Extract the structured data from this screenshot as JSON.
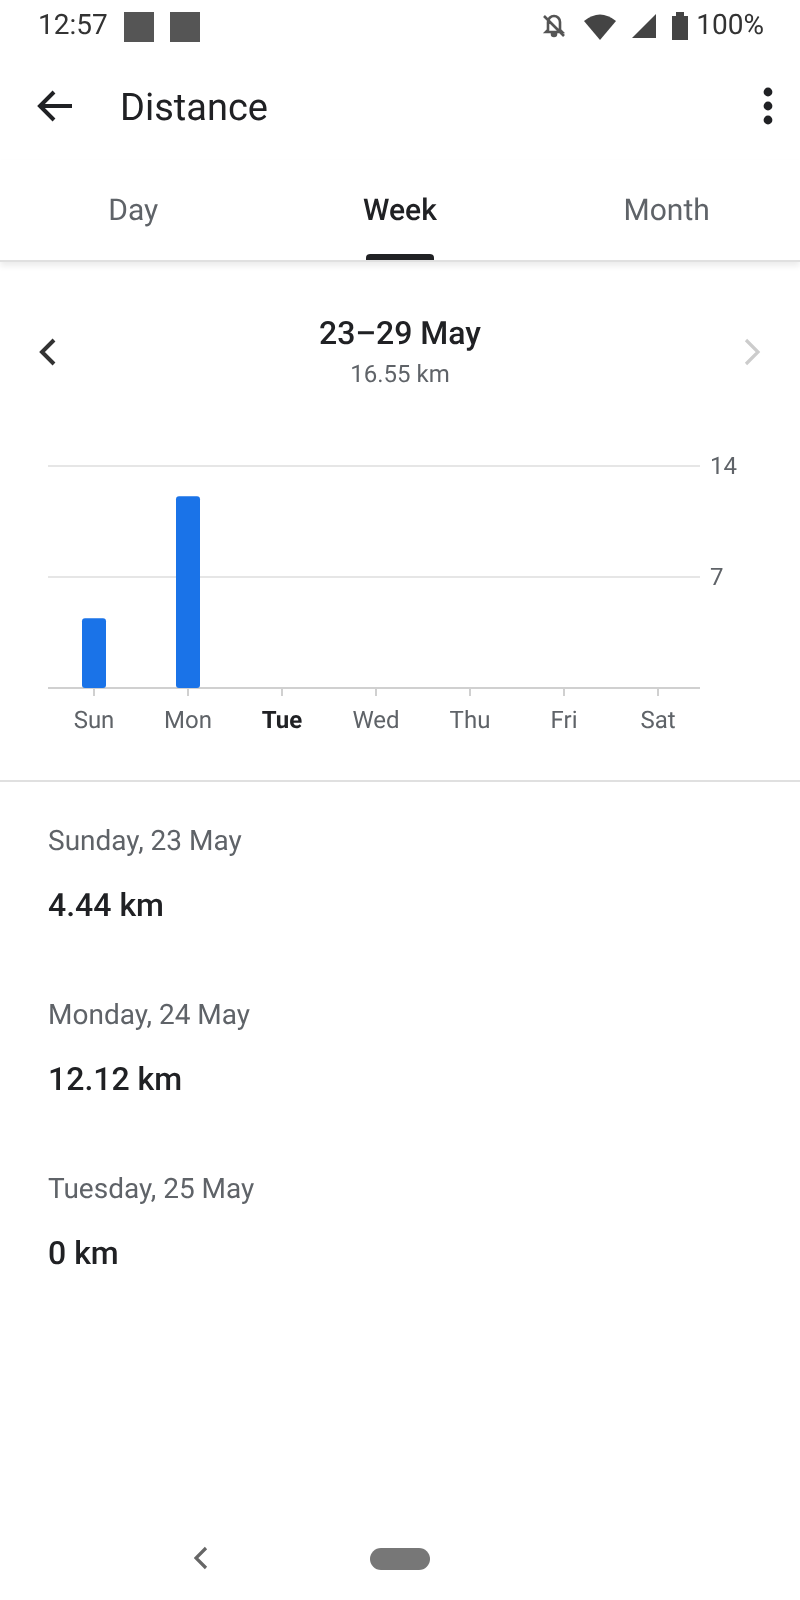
{
  "status_bar": {
    "time": "12:57",
    "battery": "100%"
  },
  "app_bar": {
    "title": "Distance"
  },
  "tabs": [
    {
      "label": "Day",
      "selected": false
    },
    {
      "label": "Week",
      "selected": true
    },
    {
      "label": "Month",
      "selected": false
    }
  ],
  "period": {
    "title": "23–29 May",
    "total": "16.55 km",
    "next_disabled": true
  },
  "day_labels": [
    {
      "selected": false
    },
    {
      "selected": false
    },
    {
      "selected": true
    },
    {
      "selected": false
    },
    {
      "selected": false
    },
    {
      "selected": false
    },
    {
      "selected": false
    }
  ],
  "chart_data": {
    "type": "bar",
    "categories": [
      "Sun",
      "Mon",
      "Tue",
      "Wed",
      "Thu",
      "Fri",
      "Sat"
    ],
    "series": [
      {
        "color": "#1a73e8",
        "values": [
          4.4,
          12.1,
          0,
          null,
          null,
          null,
          null
        ]
      }
    ],
    "ylim": [
      0,
      14
    ],
    "yticks": [
      7,
      14
    ]
  },
  "entries": [
    {
      "date": "Sunday, 23 May",
      "distance": "4.44 km"
    },
    {
      "date": "Monday, 24 May",
      "distance": "12.12 km"
    },
    {
      "date": "Tuesday, 25 May",
      "distance": "0 km"
    }
  ]
}
